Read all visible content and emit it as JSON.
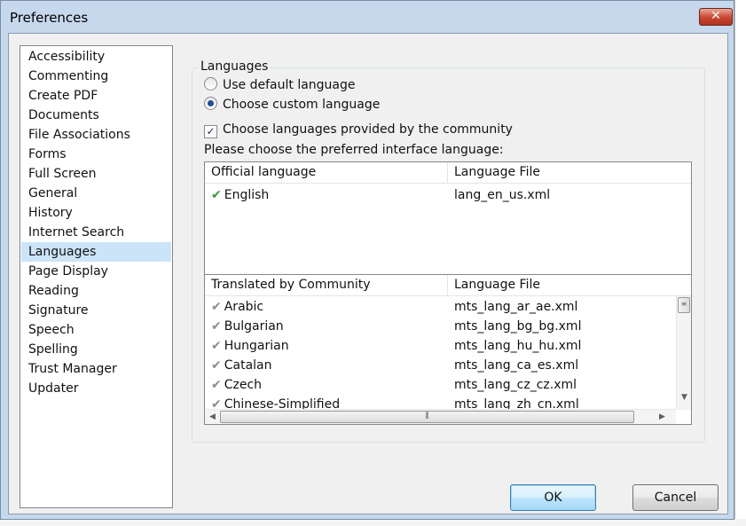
{
  "window": {
    "title": "Preferences",
    "close_label": "✕"
  },
  "sidebar": {
    "items": [
      {
        "label": "Accessibility"
      },
      {
        "label": "Commenting"
      },
      {
        "label": "Create PDF"
      },
      {
        "label": "Documents"
      },
      {
        "label": "File Associations"
      },
      {
        "label": "Forms"
      },
      {
        "label": "Full Screen"
      },
      {
        "label": "General"
      },
      {
        "label": "History"
      },
      {
        "label": "Internet Search"
      },
      {
        "label": "Languages"
      },
      {
        "label": "Page Display"
      },
      {
        "label": "Reading"
      },
      {
        "label": "Signature"
      },
      {
        "label": "Speech"
      },
      {
        "label": "Spelling"
      },
      {
        "label": "Trust Manager"
      },
      {
        "label": "Updater"
      }
    ],
    "selected": "Languages"
  },
  "languages": {
    "group_title": "Languages",
    "option_default": "Use default language",
    "option_custom": "Choose custom language",
    "selected_option": "custom",
    "community_checkbox": {
      "label": "Choose languages provided by the community",
      "checked": true
    },
    "prompt": "Please choose the preferred interface language:",
    "official": {
      "headers": [
        "Official language",
        "Language File"
      ],
      "rows": [
        {
          "language": "English",
          "file": "lang_en_us.xml"
        }
      ]
    },
    "community": {
      "headers": [
        "Translated by Community",
        "Language File"
      ],
      "rows": [
        {
          "language": "Arabic",
          "file": "mts_lang_ar_ae.xml"
        },
        {
          "language": "Bulgarian",
          "file": "mts_lang_bg_bg.xml"
        },
        {
          "language": "Hungarian",
          "file": "mts_lang_hu_hu.xml"
        },
        {
          "language": "Catalan",
          "file": "mts_lang_ca_es.xml"
        },
        {
          "language": "Czech",
          "file": "mts_lang_cz_cz.xml"
        },
        {
          "language": "Chinese-Simplified",
          "file": "mts_lang_zh_cn.xml"
        }
      ]
    }
  },
  "buttons": {
    "ok": "OK",
    "cancel": "Cancel"
  },
  "colors": {
    "selection": "#cce4f7",
    "official_check": "#2e9a2e",
    "community_check": "#8d8d8d"
  }
}
